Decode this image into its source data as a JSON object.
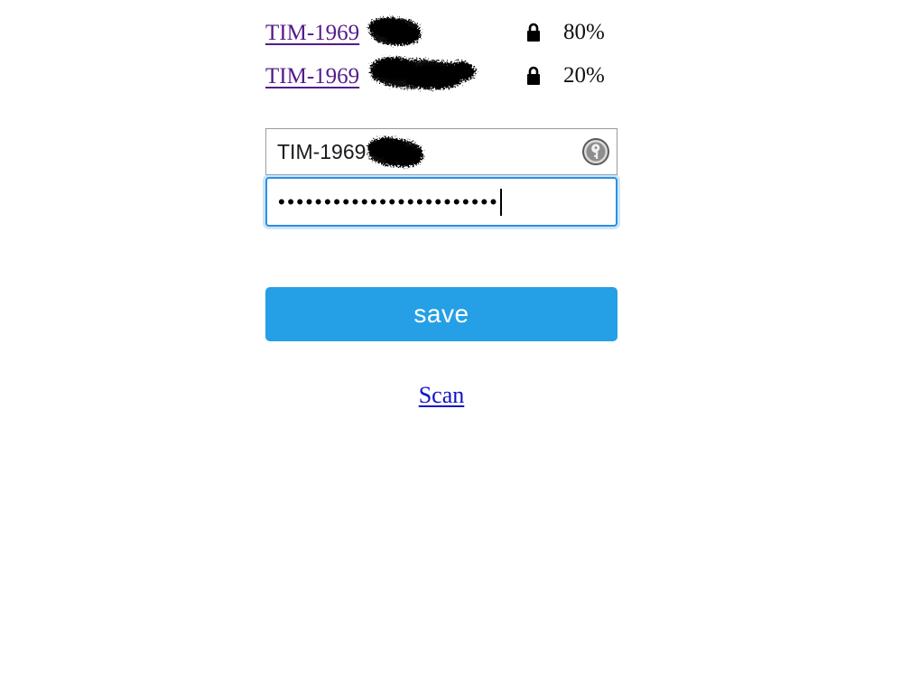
{
  "entries": {
    "rows": [
      {
        "label": "TIM-1969",
        "redacted": true,
        "lock_icon": "padlock-icon",
        "percent": "80%"
      },
      {
        "label": "TIM-1969",
        "redacted": true,
        "lock_icon": "padlock-icon",
        "percent": "20%"
      }
    ]
  },
  "form": {
    "username": {
      "value": "TIM-1969",
      "redacted": true,
      "placeholder": "",
      "badge_icon": "key-icon"
    },
    "password": {
      "masked_value": "••••••••••••••••••••••••",
      "placeholder": "",
      "focused": true,
      "caret_visible": true
    }
  },
  "actions": {
    "save_label": "save",
    "scan_label": "Scan"
  },
  "colors": {
    "accent_blue": "#259fe6",
    "focus_border": "#2f8fe0",
    "visited_link": "#551a8b",
    "link_blue": "#1111cc",
    "field_border": "#9b9b9b",
    "text": "#1a1a1a",
    "background": "#ffffff"
  }
}
